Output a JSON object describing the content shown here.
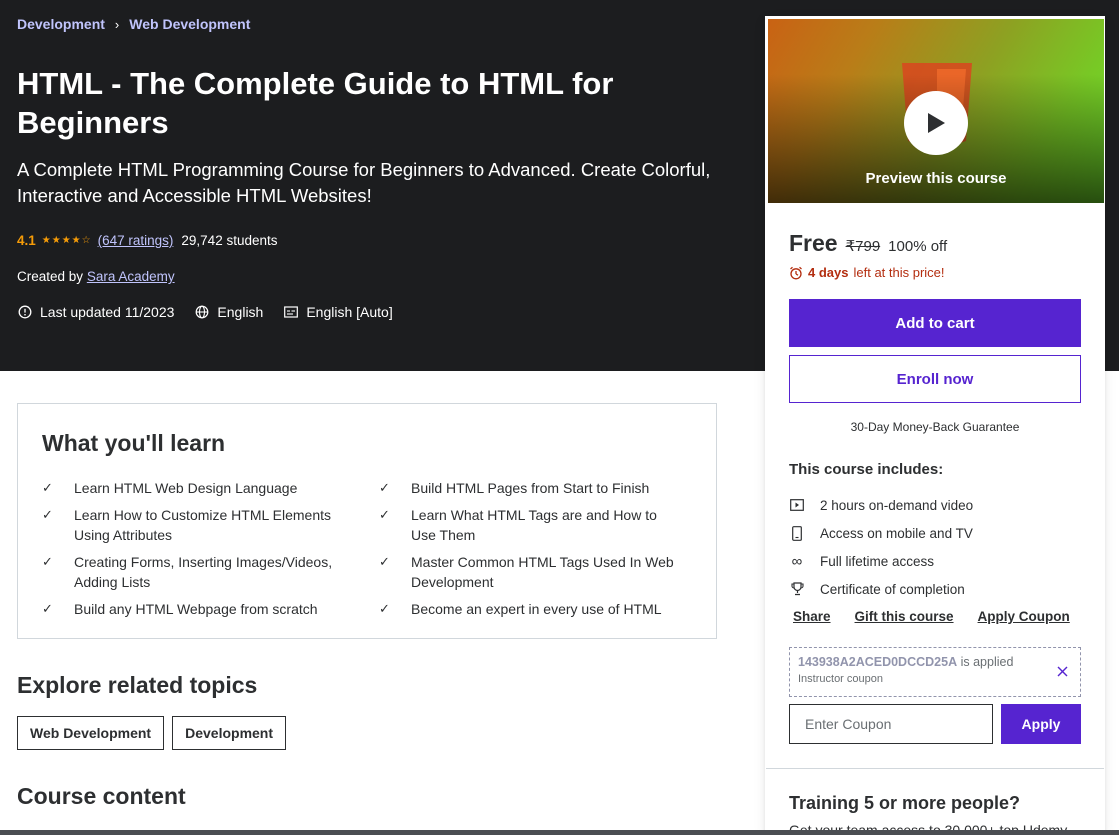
{
  "breadcrumb": {
    "items": [
      "Development",
      "Web Development"
    ]
  },
  "course": {
    "title": "HTML - The Complete Guide to HTML for Beginners",
    "subtitle": "A Complete HTML Programming Course for Beginners to Advanced. Create Colorful, Interactive and Accessible HTML Websites!",
    "rating": "4.1",
    "ratings_count": "(647 ratings)",
    "students": "29,742 students",
    "created_by_label": "Created by",
    "instructor": "Sara Academy",
    "last_updated": "Last updated 11/2023",
    "language": "English",
    "captions": "English [Auto]"
  },
  "learn": {
    "title": "What you'll learn",
    "items": [
      "Learn HTML Web Design Language",
      "Build HTML Pages from Start to Finish",
      "Learn How to Customize HTML Elements Using Attributes",
      "Learn What HTML Tags are and How to Use Them",
      "Creating Forms, Inserting Images/Videos, Adding Lists",
      "Master Common HTML Tags Used In Web Development",
      "Build any HTML Webpage from scratch",
      "Become an expert in every use of HTML"
    ]
  },
  "related": {
    "title": "Explore related topics",
    "topics": [
      "Web Development",
      "Development"
    ]
  },
  "course_content_title": "Course content",
  "sidebar": {
    "preview_label": "Preview this course",
    "price": "Free",
    "original_price": "₹799",
    "discount": "100% off",
    "timer_bold": "4 days",
    "timer_rest": "left at this price!",
    "add_to_cart": "Add to cart",
    "enroll_now": "Enroll now",
    "guarantee": "30-Day Money-Back Guarantee",
    "includes_title": "This course includes:",
    "includes": [
      "2 hours on-demand video",
      "Access on mobile and TV",
      "Full lifetime access",
      "Certificate of completion"
    ],
    "links": [
      "Share",
      "Gift this course",
      "Apply Coupon"
    ],
    "coupon_code": "143938A2ACED0DCCD25A",
    "coupon_applied": "is applied",
    "coupon_type": "Instructor coupon",
    "coupon_placeholder": "Enter Coupon",
    "apply": "Apply",
    "training_title": "Training 5 or more people?",
    "training_text": "Get your team access to 30,000+ top Udemy"
  },
  "colors": {
    "brand_purple": "#5624d0",
    "hero_bg": "#1c1d1f",
    "link_lavender": "#c0c4fc",
    "star_orange": "#f69c08",
    "alert_red": "#b32d0f"
  }
}
